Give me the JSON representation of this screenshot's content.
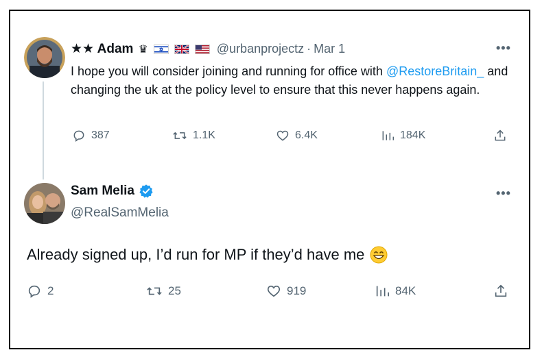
{
  "tweet1": {
    "name": "★★ Adam",
    "handle": "@urbanprojectz",
    "separator": "·",
    "date": "Mar 1",
    "text_pre": "I hope you will consider joining and running for office with ",
    "mention": "@RestoreBritain_",
    "text_post": " and changing the uk at the policy level to ensure that this never happens again.",
    "actions": {
      "replies": "387",
      "reposts": "1.1K",
      "likes": "6.4K",
      "views": "184K"
    }
  },
  "tweet2": {
    "name": "Sam Melia",
    "handle": "@RealSamMelia",
    "text": "Already signed up, I’d run for MP if they’d have me",
    "actions": {
      "replies": "2",
      "reposts": "25",
      "likes": "919",
      "views": "84K"
    }
  },
  "icons": {
    "more": "more-horizontal-icon",
    "reply": "reply-icon",
    "repost": "repost-icon",
    "like": "heart-icon",
    "views": "bar-chart-icon",
    "share": "share-icon",
    "verified": "verified-badge-icon",
    "crown": "chess-piece-icon",
    "flags": [
      "israel-flag-icon",
      "uk-flag-icon",
      "us-flag-icon"
    ],
    "emoji": "grinning-face-emoji"
  },
  "colors": {
    "accent": "#1d9bf0",
    "secondary_text": "#536471",
    "text": "#0f1419",
    "thread_line": "#cfd9de"
  }
}
